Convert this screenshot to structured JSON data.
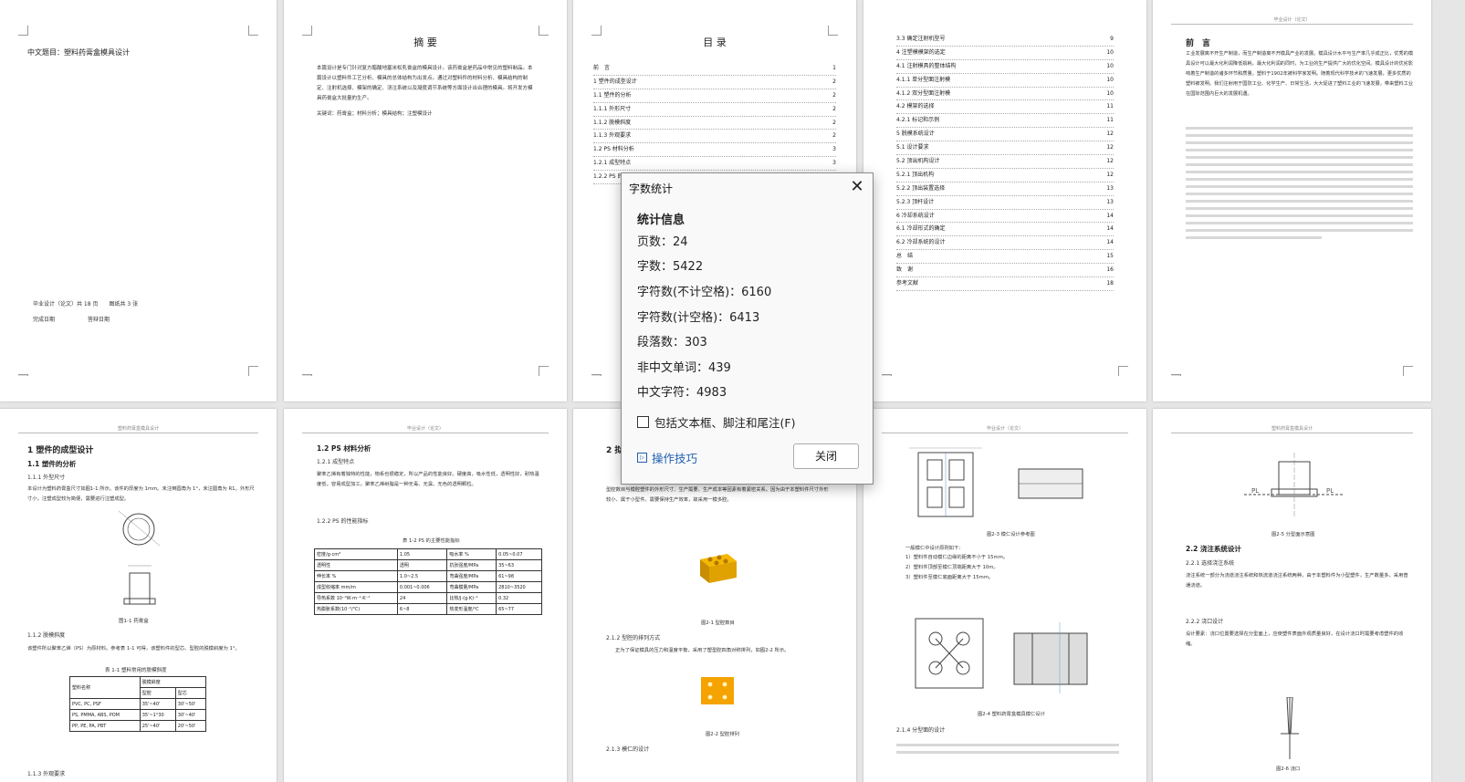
{
  "dialog": {
    "title": "字数统计",
    "close_icon": "close-icon",
    "section": "统计信息",
    "stats": [
      "页数：24",
      "字数：5422",
      "字符数(不计空格)：6160",
      "字符数(计空格)：6413",
      "段落数：303",
      "非中文单词：439",
      "中文字符：4983"
    ],
    "checkbox_label": "包括文本框、脚注和尾注(F)",
    "tips_label": "操作技巧",
    "close_label": "关闭"
  },
  "p1": {
    "title": "中文题目：塑料药膏盒模具设计",
    "footer1": "毕业设计（论文）共 18 页　　图纸共 3 张",
    "footer2": "完成日期　　　　　　答辩日期"
  },
  "p2": {
    "heading": "摘 要",
    "body": "本篇设计是专门针对复方醋酸地塞米松乳膏盒的模具设计。该药膏盒是药品中常见的塑料制品。本篇设计以塑料件工艺分析、模具的总体结构为出发点。通过对塑料件的材料分析、模具结构的制定、注射机选择、模架的确定、浇注系统以及凝度调节系统等方面设计出合理的模具。将开发方模具药膏盒大批量的生产。",
    "keywords": "关键词：药膏盒；材料分析；模具结构；注塑模设计"
  },
  "p3": {
    "heading": "目 录",
    "toc": [
      [
        "前　言",
        "1"
      ],
      [
        "1 塑件的成型设计",
        "2"
      ],
      [
        "1.1 塑件的分析",
        "2"
      ],
      [
        "1.1.1 外形尺寸",
        "2"
      ],
      [
        "1.1.2 脱模斜度",
        "2"
      ],
      [
        "1.1.3 外观要求",
        "2"
      ],
      [
        "1.2 PS 材料分析",
        "3"
      ],
      [
        "1.2.1 成型特点",
        "3"
      ],
      [
        "1.2.2 PS 的性能指标",
        "3"
      ]
    ]
  },
  "p4": {
    "toc": [
      [
        "3.3 确定注射机型号",
        "9"
      ],
      [
        "4 注塑模模架的选定",
        "10"
      ],
      [
        "4.1 注射模具的整体结构",
        "10"
      ],
      [
        "4.1.1 单分型面注射模",
        "10"
      ],
      [
        "4.1.2 双分型面注射模",
        "10"
      ],
      [
        "4.2 模架的选择",
        "11"
      ],
      [
        "4.2.1 标记和示例",
        "11"
      ],
      [
        "5 脱模系统设计",
        "12"
      ],
      [
        "5.1 设计要求",
        "12"
      ],
      [
        "5.2 顶出机构设计",
        "12"
      ],
      [
        "5.2.1 顶出机构",
        "12"
      ],
      [
        "5.2.2 顶出装置选择",
        "13"
      ],
      [
        "5.2.3 顶杆设计",
        "13"
      ],
      [
        "6 冷却系统设计",
        "14"
      ],
      [
        "6.1 冷却形式的确定",
        "14"
      ],
      [
        "6.2 冷却系统的设计",
        "14"
      ],
      [
        "总　结",
        "15"
      ],
      [
        "致　谢",
        "16"
      ],
      [
        "参考文献",
        "18"
      ]
    ]
  },
  "p5": {
    "header": "毕业设计（论文）",
    "heading": "前　言",
    "body": "工业发展离不开生产制造，而生产制造离不开模具产业的发展。模具设计水平与生产率几乎成正比，优秀的模具设计可以最大化利润降低损耗，最大化利润的同时，为工业的生产提供广大的优化空间。模具设计的优劣影响着生产制造的诸多环节和质量。塑料于1902年被科学家发明。随着现代科学技术的飞速发展，更多优质的塑料被发明。我们注射用于国防工业、化学生产、日常生活，大大促进了塑料工业的飞速发展，带来塑料工业在国际范围内巨大的发展机遇。"
  },
  "p6": {
    "header": "塑料药膏盒模具设计",
    "h1": "1 塑件的成型设计",
    "h11": "1.1  塑件的分析",
    "h111": "1.1.1 外型尺寸",
    "t1": "本设计为塑料药膏盒尺寸如图1-1 所示。该件的厚度为 1mm。未注倒圆角为 1°，未注圆角为 R1。外形尺寸小，注塑成型较为简便，需要进行注塑成型。",
    "fig": "图1-1  药膏盒",
    "h112": "1.1.2 脱模斜度",
    "t2": "该塑件所以聚苯乙烯（PS）为原材料。参考表 1-1 可得，该塑料件的型芯、型腔的脱模斜度为 1°。",
    "tcap": "表 1-1  塑料常用的脱模斜度",
    "h113": "1.1.3 外观要求"
  },
  "p7": {
    "header": "毕业设计（论文）",
    "h12": "1.2 PS 材料分析",
    "h121": "1.2.1 成型特点",
    "t1": "聚苯乙烯有着独特的性能，物系也很稳定，所以产品的性能良好。硬度高，吸水性低，透明性好，耐热温度低，容易成型加工。聚苯乙烯树脂是一种无毒、无臭、无色的透明颗粒。",
    "h122": "1.2.2 PS 的性能指标",
    "tcap": "表 1-2 PS 的主要性能指标"
  },
  "p8": {
    "h2": "2 拟",
    "t1": "型腔数目与模腔塑件的外形尺寸、生产需要、生产成本等因素有着紧密关系。因为由于本塑料件尺寸外形较小、属于小型件。需要保持生产效率，故采用一模多腔。",
    "fig1": "图2-1 型腔数目",
    "h212": "2.1.2 型腔的排列方式",
    "t2": "正为了保证模具的压力和温度平衡，采用了塑型腔四角对称排列，如图2-2 所示。",
    "fig2": "图2-2 型腔排列",
    "h213": "2.1.3 模仁的设计"
  },
  "p9": {
    "header": "毕业设计（论文）",
    "fig1": "图2-3 模仁设计参考图",
    "t1": "一般模仁中设计原则如下：",
    "list": [
      "1）塑料件自动模仁边缘的距离不小于 15mm。",
      "2）塑料件顶部至模仁顶端距离大于 10m。",
      "3）塑料件至模仁底面距离大于 15mm。"
    ],
    "fig2": "图2-4 塑料药膏盒模具模仁设计",
    "h214": "2.1.4 分型面的设计"
  },
  "p10": {
    "header": "塑料药膏盒模具设计",
    "fig1": "图2-5 分型面示意图",
    "h22": "2.2  浇注系统设计",
    "h221": "2.2.1 选择浇注系统",
    "t1": "浇注系统一部分为浇道浇注系统和热流道浇注系统两种。由于本塑料件为小型塑件，生产数量多，采用普通浇道。",
    "h222": "2.2.2 浇口设计",
    "t2": "设计要素：浇口位置要选择在分型面上，应使塑件表面外观质量良好，在设计浇口时需要考虑塑件的收缩。",
    "fig2": "图2-6 浇口"
  },
  "p1_glyphs": [
    "PL",
    "PL"
  ]
}
